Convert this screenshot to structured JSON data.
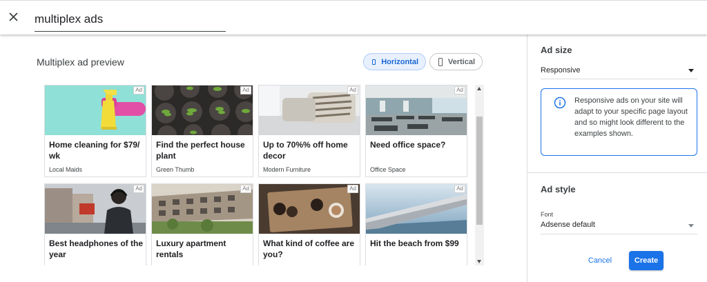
{
  "search": {
    "query": "multiplex ads"
  },
  "preview": {
    "title": "Multiplex ad preview",
    "layout_toggle": {
      "horizontal_label": "Horizontal",
      "vertical_label": "Vertical",
      "selected": "Horizontal"
    }
  },
  "ads": [
    {
      "title": "Home cleaning for $79/ wk",
      "advertiser": "Local Maids",
      "badge": "Ad",
      "icon": "spray-bottle-image"
    },
    {
      "title": "Find the perfect house plant",
      "advertiser": "Green Thumb",
      "badge": "Ad",
      "icon": "seedling-pots-image"
    },
    {
      "title": "Up to 70%% off home decor",
      "advertiser": "Modern Furniture",
      "badge": "Ad",
      "icon": "cushion-sofa-image"
    },
    {
      "title": "Need office space?",
      "advertiser": "Office Space",
      "badge": "Ad",
      "icon": "open-office-image"
    },
    {
      "title": "Best headphones of the year",
      "advertiser": "",
      "badge": "Ad",
      "icon": "headphones-street-image"
    },
    {
      "title": "Luxury apartment rentals",
      "advertiser": "",
      "badge": "Ad",
      "icon": "apartment-building-image"
    },
    {
      "title": "What kind of coffee are you?",
      "advertiser": "",
      "badge": "Ad",
      "icon": "coffee-tray-image"
    },
    {
      "title": "Hit the beach from $99",
      "advertiser": "",
      "badge": "Ad",
      "icon": "airplane-wing-image"
    }
  ],
  "sidebar": {
    "ad_size": {
      "heading": "Ad size",
      "selected": "Responsive",
      "info_text": "Responsive ads on your site will adapt to your specific page layout and so might look different to the examples shown."
    },
    "ad_style": {
      "heading": "Ad style",
      "font_label": "Font",
      "font_value": "Adsense default"
    },
    "cancel_label": "Cancel",
    "create_label": "Create"
  },
  "colors": {
    "accent": "#1a73e8",
    "toggle_selected_bg": "#e8f0fe",
    "divider": "#dadce0"
  }
}
